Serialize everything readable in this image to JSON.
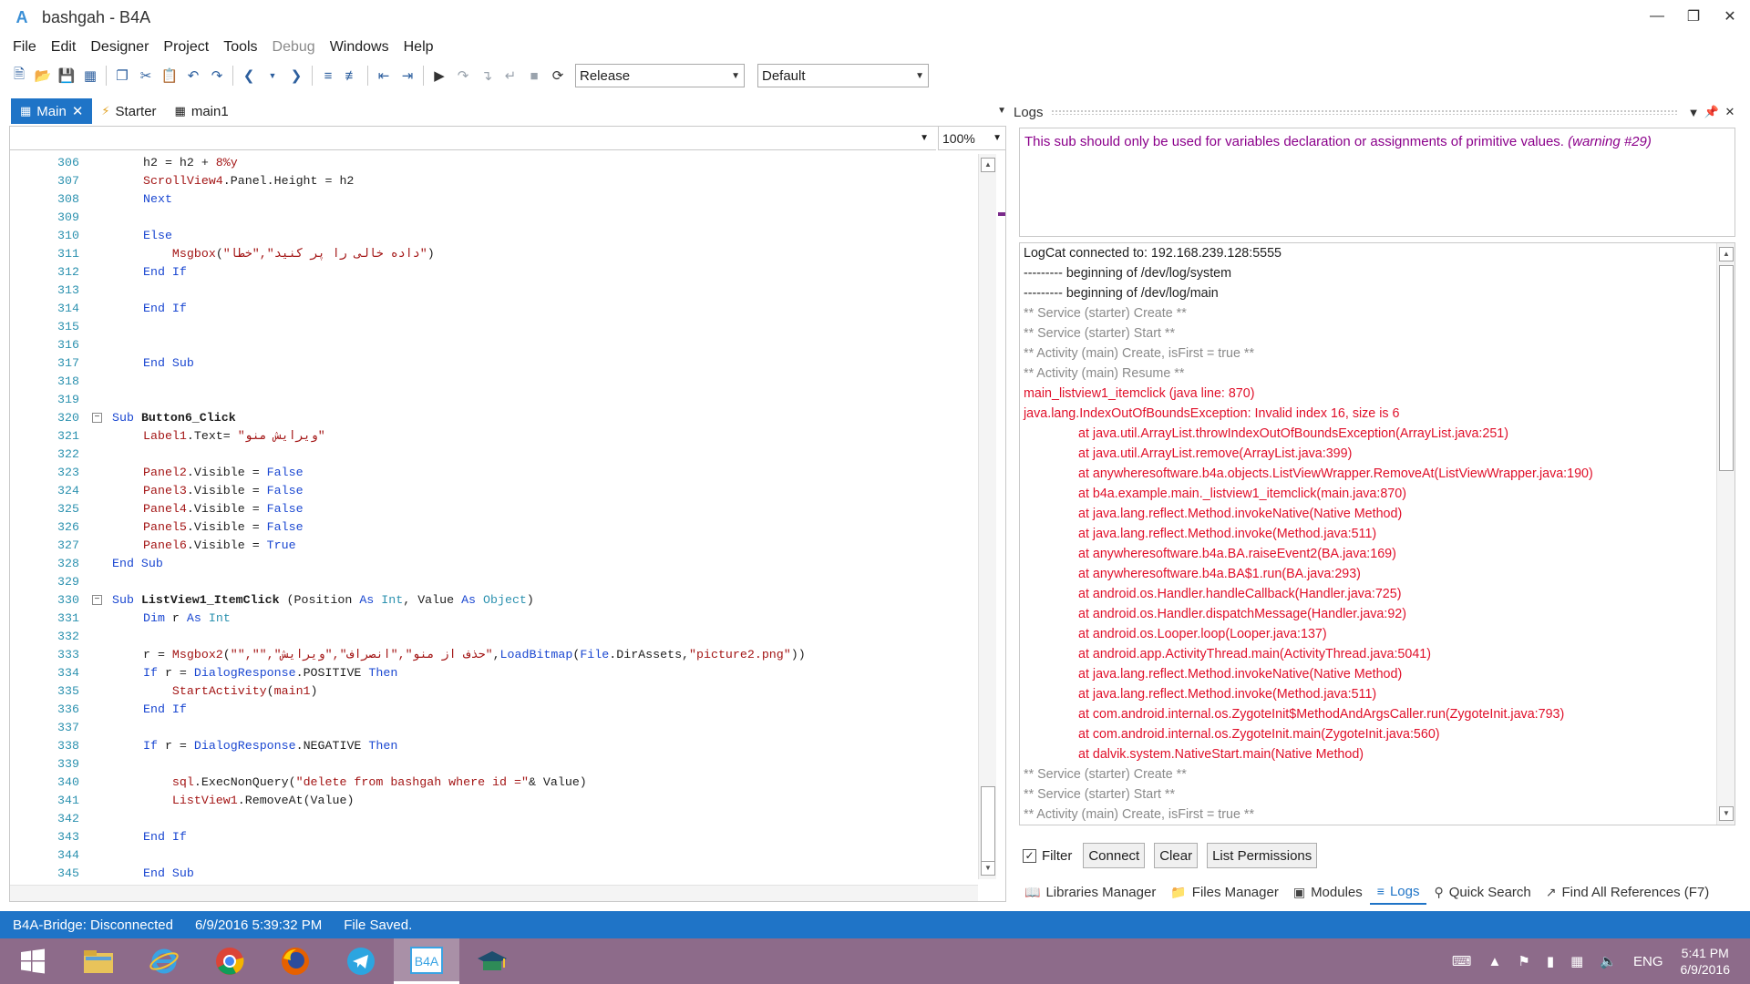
{
  "window": {
    "title": "bashgah - B4A",
    "logo": "A"
  },
  "menu": [
    "File",
    "Edit",
    "Designer",
    "Project",
    "Tools",
    "Debug",
    "Windows",
    "Help"
  ],
  "toolbar": {
    "build_config": "Release",
    "device": "Default"
  },
  "tabs": [
    {
      "label": "Main"
    },
    {
      "label": "Starter"
    },
    {
      "label": "main1"
    }
  ],
  "editor": {
    "zoom": "100%"
  },
  "code_lines": [
    {
      "n": "306",
      "html": "h2 = h2 + <span class='str'>8%y</span>"
    },
    {
      "n": "307",
      "html": "<span class='obj'>ScrollView4</span>.Panel.Height = h2"
    },
    {
      "n": "308",
      "html": "<span class='kw'>Next</span>"
    },
    {
      "n": "309",
      "html": ""
    },
    {
      "n": "310",
      "html": "<span class='kw'>Else</span>"
    },
    {
      "n": "311",
      "html": "    <span class='fn'>Msgbox</span>(<span class='str'>\"داده خالی را پر کنید\",\"خطا\"</span>)"
    },
    {
      "n": "312",
      "html": "<span class='kw'>End If</span>"
    },
    {
      "n": "313",
      "html": ""
    },
    {
      "n": "314",
      "html": "<span class='kw'>End If</span>"
    },
    {
      "n": "315",
      "html": ""
    },
    {
      "n": "316",
      "html": ""
    },
    {
      "n": "317",
      "html": "<span class='kw'>End Sub</span>"
    },
    {
      "n": "318",
      "html": ""
    },
    {
      "n": "319",
      "html": ""
    },
    {
      "n": "320",
      "fold": "−",
      "indent": "sub",
      "html": "<span class='kw'>Sub</span> <span class='bold'>Button6_Click</span>"
    },
    {
      "n": "321",
      "html": "<span class='obj'>Label1</span>.Text= <span class='str'>\"ویرایش منو\"</span>"
    },
    {
      "n": "322",
      "html": ""
    },
    {
      "n": "323",
      "html": "<span class='obj'>Panel2</span>.Visible = <span class='kw'>False</span>"
    },
    {
      "n": "324",
      "html": "<span class='obj'>Panel3</span>.Visible = <span class='kw'>False</span>"
    },
    {
      "n": "325",
      "html": "<span class='obj'>Panel4</span>.Visible = <span class='kw'>False</span>"
    },
    {
      "n": "326",
      "html": "<span class='obj'>Panel5</span>.Visible = <span class='kw'>False</span>"
    },
    {
      "n": "327",
      "html": "<span class='obj'>Panel6</span>.Visible = <span class='kw'>True</span>"
    },
    {
      "n": "328",
      "indent": "sub",
      "html": "<span class='kw'>End Sub</span>"
    },
    {
      "n": "329",
      "html": ""
    },
    {
      "n": "330",
      "fold": "−",
      "indent": "sub",
      "html": "<span class='kw'>Sub</span> <span class='bold'>ListView1_ItemClick</span> (Position <span class='kw'>As</span> <span class='ty'>Int</span>, Value <span class='kw'>As</span> <span class='ty'>Object</span>)"
    },
    {
      "n": "331",
      "html": "<span class='kw'>Dim</span> r <span class='kw'>As</span> <span class='ty'>Int</span>"
    },
    {
      "n": "332",
      "html": ""
    },
    {
      "n": "333",
      "html": "r = <span class='fn'>Msgbox2</span>(<span class='str'>\"\",\"\",\"حذف از منو\",\"انصراف\",\"ویرایش\"</span>,<span class='kw'>LoadBitmap</span>(<span class='kw'>File</span>.DirAssets,<span class='str'>\"picture2.png\"</span>))"
    },
    {
      "n": "334",
      "html": "<span class='kw'>If</span> r = <span class='kw'>DialogResponse</span>.POSITIVE <span class='kw'>Then</span>"
    },
    {
      "n": "335",
      "html": "    <span class='fn'>StartActivity</span>(<span class='obj'>main1</span>)"
    },
    {
      "n": "336",
      "html": "<span class='kw'>End If</span>"
    },
    {
      "n": "337",
      "html": ""
    },
    {
      "n": "338",
      "html": "<span class='kw'>If</span> r = <span class='kw'>DialogResponse</span>.NEGATIVE <span class='kw'>Then</span>"
    },
    {
      "n": "339",
      "html": ""
    },
    {
      "n": "340",
      "html": "    <span class='obj'>sql</span>.ExecNonQuery(<span class='str'>\"delete from bashgah where id =\"</span>&amp; Value)"
    },
    {
      "n": "341",
      "html": "    <span class='obj'>ListView1</span>.RemoveAt(Value)"
    },
    {
      "n": "342",
      "html": ""
    },
    {
      "n": "343",
      "html": "<span class='kw'>End If</span>"
    },
    {
      "n": "344",
      "html": ""
    },
    {
      "n": "345",
      "html": "<span class='kw'>End Sub</span>"
    }
  ],
  "logs": {
    "title": "Logs",
    "warning": "This sub should only be used for variables declaration or assignments of primitive values.",
    "warning_code": "(warning #29)",
    "lines": [
      {
        "c": "n",
        "t": "LogCat connected to: 192.168.239.128:5555"
      },
      {
        "c": "n",
        "t": "--------- beginning of /dev/log/system"
      },
      {
        "c": "n",
        "t": "--------- beginning of /dev/log/main"
      },
      {
        "c": "g",
        "t": "** Service (starter) Create **"
      },
      {
        "c": "g",
        "t": "** Service (starter) Start **"
      },
      {
        "c": "g",
        "t": "** Activity (main) Create, isFirst = true **"
      },
      {
        "c": "g",
        "t": "** Activity (main) Resume **"
      },
      {
        "c": "r",
        "t": "main_listview1_itemclick (java line: 870)"
      },
      {
        "c": "r",
        "t": "java.lang.IndexOutOfBoundsException: Invalid index 16, size is 6"
      },
      {
        "c": "r i",
        "t": "at java.util.ArrayList.throwIndexOutOfBoundsException(ArrayList.java:251)"
      },
      {
        "c": "r i",
        "t": "at java.util.ArrayList.remove(ArrayList.java:399)"
      },
      {
        "c": "r i",
        "t": "at anywheresoftware.b4a.objects.ListViewWrapper.RemoveAt(ListViewWrapper.java:190)"
      },
      {
        "c": "r i",
        "t": "at b4a.example.main._listview1_itemclick(main.java:870)"
      },
      {
        "c": "r i",
        "t": "at java.lang.reflect.Method.invokeNative(Native Method)"
      },
      {
        "c": "r i",
        "t": "at java.lang.reflect.Method.invoke(Method.java:511)"
      },
      {
        "c": "r i",
        "t": "at anywheresoftware.b4a.BA.raiseEvent2(BA.java:169)"
      },
      {
        "c": "r i",
        "t": "at anywheresoftware.b4a.BA$1.run(BA.java:293)"
      },
      {
        "c": "r i",
        "t": "at android.os.Handler.handleCallback(Handler.java:725)"
      },
      {
        "c": "r i",
        "t": "at android.os.Handler.dispatchMessage(Handler.java:92)"
      },
      {
        "c": "r i",
        "t": "at android.os.Looper.loop(Looper.java:137)"
      },
      {
        "c": "r i",
        "t": "at android.app.ActivityThread.main(ActivityThread.java:5041)"
      },
      {
        "c": "r i",
        "t": "at java.lang.reflect.Method.invokeNative(Native Method)"
      },
      {
        "c": "r i",
        "t": "at java.lang.reflect.Method.invoke(Method.java:511)"
      },
      {
        "c": "r i",
        "t": "at com.android.internal.os.ZygoteInit$MethodAndArgsCaller.run(ZygoteInit.java:793)"
      },
      {
        "c": "r i",
        "t": "at com.android.internal.os.ZygoteInit.main(ZygoteInit.java:560)"
      },
      {
        "c": "r i",
        "t": "at dalvik.system.NativeStart.main(Native Method)"
      },
      {
        "c": "g",
        "t": "** Service (starter) Create **"
      },
      {
        "c": "g",
        "t": "** Service (starter) Start **"
      },
      {
        "c": "g",
        "t": "** Activity (main) Create, isFirst = true **"
      }
    ],
    "filter_label": "Filter",
    "filter_checked": true,
    "buttons": {
      "connect": "Connect",
      "clear": "Clear",
      "list_permissions": "List Permissions"
    }
  },
  "panel_tabs": [
    "Libraries Manager",
    "Files Manager",
    "Modules",
    "Logs",
    "Quick Search",
    "Find All References (F7)"
  ],
  "status": {
    "bridge": "B4A-Bridge: Disconnected",
    "timestamp": "6/9/2016 5:39:32 PM",
    "message": "File Saved."
  },
  "tray": {
    "lang": "ENG",
    "time": "5:41 PM",
    "date": "6/9/2016"
  },
  "colors": {
    "accent": "#1f74c7",
    "error": "#e0102a",
    "warning": "#8b008b",
    "taskbar": "#8d6b8a"
  }
}
